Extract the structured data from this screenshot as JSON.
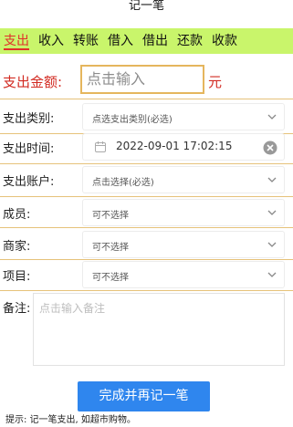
{
  "app": {
    "title": "记一笔"
  },
  "tabs": [
    {
      "label": "支出",
      "active": true
    },
    {
      "label": "收入"
    },
    {
      "label": "转账"
    },
    {
      "label": "借入"
    },
    {
      "label": "借出"
    },
    {
      "label": "还款"
    },
    {
      "label": "收款"
    }
  ],
  "amount": {
    "label": "支出金额:",
    "placeholder": "点击输入",
    "unit": "元"
  },
  "fields": {
    "category": {
      "label": "支出类别:",
      "value": "点选支出类别(必选)"
    },
    "time": {
      "label": "支出时间:",
      "value": "2022-09-01 17:02:15"
    },
    "account": {
      "label": "支出账户:",
      "value": "点击选择(必选)"
    },
    "member": {
      "label": "成员:",
      "value": "可不选择"
    },
    "merchant": {
      "label": "商家:",
      "value": "可不选择"
    },
    "project": {
      "label": "项目:",
      "value": "可不选择"
    }
  },
  "remark": {
    "label": "备注:",
    "placeholder": "点击输入备注"
  },
  "submit": {
    "label": "完成并再记一笔"
  },
  "hint": {
    "text": "提示:   记一笔支出, 如超市购物。"
  },
  "colors": {
    "tab_bar": "#c9f56b",
    "accent_red": "#e0302a",
    "submit_blue": "#2f86ee",
    "amount_border": "#e5b65d"
  }
}
